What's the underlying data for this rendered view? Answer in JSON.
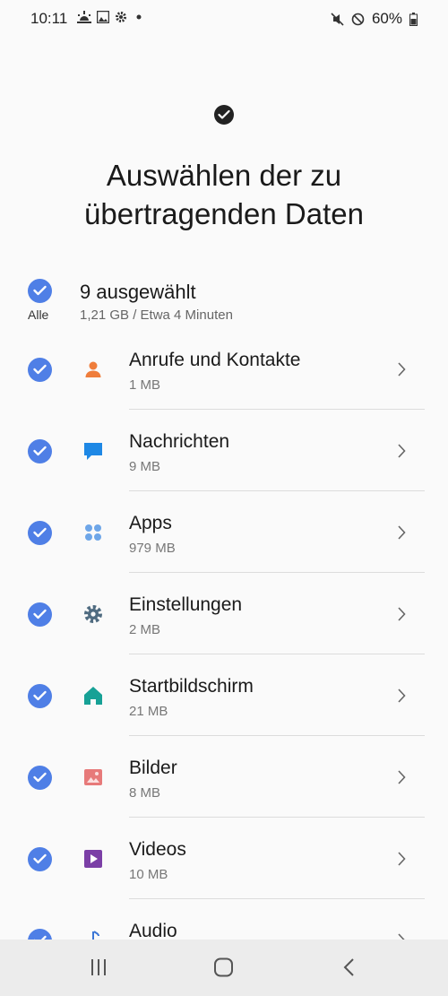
{
  "status": {
    "time": "10:11",
    "battery": "60%"
  },
  "header": {
    "title_line1": "Auswählen der zu",
    "title_line2": "übertragenden Daten"
  },
  "summary": {
    "all_label": "Alle",
    "title": "9 ausgewählt",
    "subtitle": "1,21 GB / Etwa 4 Minuten"
  },
  "items": [
    {
      "title": "Anrufe und Kontakte",
      "size": "1 MB",
      "icon": "contact-icon",
      "color": "#ef7d3b"
    },
    {
      "title": "Nachrichten",
      "size": "9 MB",
      "icon": "message-icon",
      "color": "#1e88e5"
    },
    {
      "title": "Apps",
      "size": "979 MB",
      "icon": "apps-icon",
      "color": "#6ea6e8"
    },
    {
      "title": "Einstellungen",
      "size": "2 MB",
      "icon": "gear-icon",
      "color": "#4f6b80"
    },
    {
      "title": "Startbildschirm",
      "size": "21 MB",
      "icon": "home-icon",
      "color": "#17a196"
    },
    {
      "title": "Bilder",
      "size": "8 MB",
      "icon": "image-icon",
      "color": "#e77a7a"
    },
    {
      "title": "Videos",
      "size": "10 MB",
      "icon": "video-icon",
      "color": "#7b3fa6"
    },
    {
      "title": "Audio",
      "size": "",
      "icon": "music-icon",
      "color": "#3b76d6"
    }
  ],
  "colors": {
    "accent": "#4f7fe6"
  }
}
